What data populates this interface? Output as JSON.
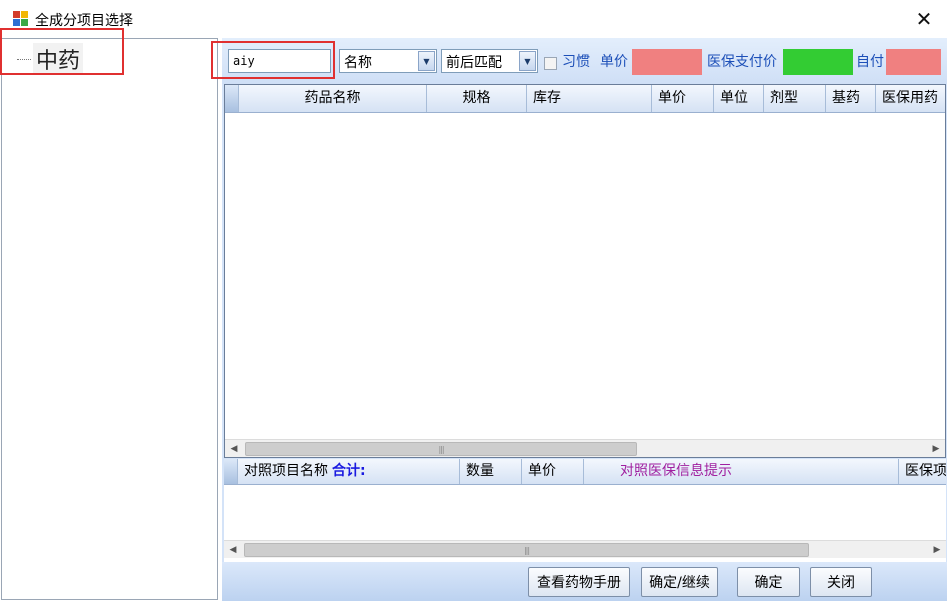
{
  "window": {
    "title": "全成分项目选择",
    "close_symbol": "✕"
  },
  "tree": {
    "root_label": "中药"
  },
  "toolbar": {
    "search_value": "aiy",
    "field_combo": "名称",
    "match_combo": "前后匹配",
    "habit_label": "习惯",
    "price_label": "单价",
    "insurance_price_label": "医保支付价",
    "self_pay_label": "自付",
    "price_color": "#f08080",
    "insurance_price_color": "#33cc33",
    "self_pay_color": "#f08080"
  },
  "grid": {
    "columns": [
      "药品名称",
      "规格",
      "库存",
      "单价",
      "单位",
      "剂型",
      "基药",
      "医保用药"
    ]
  },
  "bottom_grid": {
    "name_col": "对照项目名称",
    "sum_label": "合计:",
    "qty_col": "数量",
    "price_col": "单价",
    "hint_col": "对照医保信息提示",
    "extra_col": "医保项"
  },
  "buttons": {
    "manual": "查看药物手册",
    "confirm_continue": "确定/继续",
    "confirm": "确定",
    "close": "关闭"
  }
}
